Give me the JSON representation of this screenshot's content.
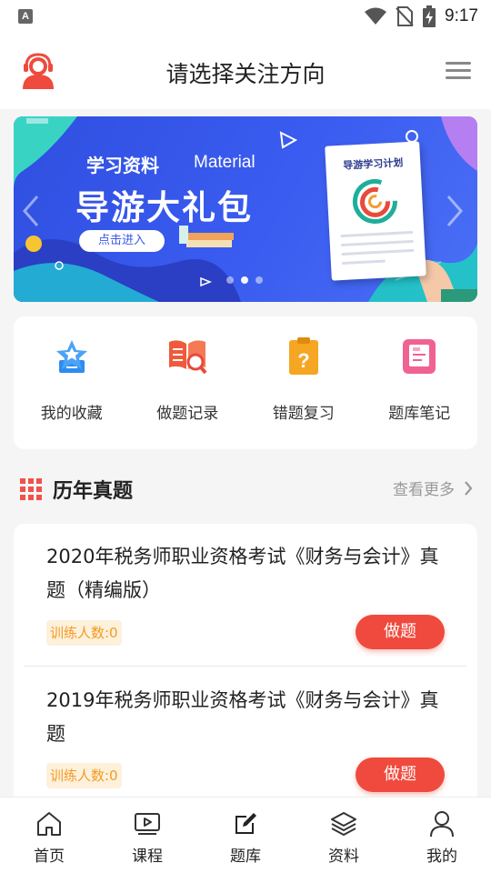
{
  "status_bar": {
    "sim_icon": "A",
    "time": "9:17",
    "icons": [
      "wifi-icon",
      "no-sim-icon",
      "battery-charging-icon"
    ]
  },
  "header": {
    "title": "请选择关注方向",
    "avatar_icon": "customer-service-icon",
    "menu_icon": "hamburger-menu-icon"
  },
  "banner": {
    "title_small": "学习资料",
    "title_small_en": "Material",
    "title_big": "导游大礼包",
    "button_label": "点击进入",
    "card_title": "导游学习计划",
    "page_count": 3,
    "active_page": 2
  },
  "quick_actions": [
    {
      "label": "我的收藏",
      "icon": "favorite-star-icon",
      "color": "#2d8cf0"
    },
    {
      "label": "做题记录",
      "icon": "book-search-icon",
      "color": "#f05a3c"
    },
    {
      "label": "错题复习",
      "icon": "clipboard-question-icon",
      "color": "#f5a623"
    },
    {
      "label": "题库笔记",
      "icon": "notebook-icon",
      "color": "#f06292"
    }
  ],
  "section": {
    "title": "历年真题",
    "more_label": "查看更多",
    "icon": "grid-icon"
  },
  "exams": [
    {
      "title": "2020年税务师职业资格考试《财务与会计》真题（精编版）",
      "badge": "训练人数:0",
      "button": "做题"
    },
    {
      "title": "2019年税务师职业资格考试《财务与会计》真题",
      "badge": "训练人数:0",
      "button": "做题"
    }
  ],
  "tabs": [
    {
      "label": "首页",
      "icon": "home-icon"
    },
    {
      "label": "课程",
      "icon": "video-play-icon"
    },
    {
      "label": "题库",
      "icon": "edit-note-icon",
      "active": true
    },
    {
      "label": "资料",
      "icon": "layers-icon"
    },
    {
      "label": "我的",
      "icon": "user-icon"
    }
  ],
  "colors": {
    "accent": "#ef4a3d",
    "banner_blue": "#3a5cf0",
    "badge_text": "#f59a23",
    "badge_bg": "#fdf1dc"
  }
}
